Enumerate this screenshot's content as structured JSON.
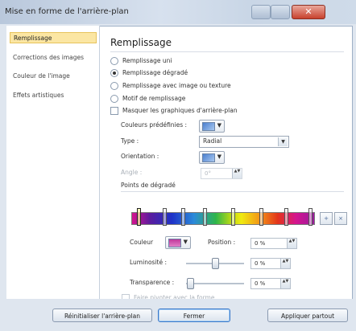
{
  "window": {
    "title": "Mise en forme de l'arrière-plan",
    "close_glyph": "✕"
  },
  "sidebar": {
    "items": [
      {
        "label": "Remplissage"
      },
      {
        "label": "Corrections des images"
      },
      {
        "label": "Couleur de l'image"
      },
      {
        "label": "Effets artistiques"
      }
    ]
  },
  "main": {
    "heading": "Remplissage",
    "fill_options": [
      {
        "label": "Remplissage uni",
        "selected": false
      },
      {
        "label": "Remplissage dégradé",
        "selected": true
      },
      {
        "label": "Remplissage avec image ou texture",
        "selected": false
      },
      {
        "label": "Motif de remplissage",
        "selected": false
      }
    ],
    "hide_graphics_label": "Masquer les graphiques d'arrière-plan",
    "preset_colors_label": "Couleurs prédéfinies :",
    "type_label": "Type :",
    "type_value": "Radial",
    "orientation_label": "Orientation :",
    "angle_label": "Angle :",
    "angle_value": "0°",
    "gradient_stops_label": "Points de dégradé",
    "color_label": "Couleur",
    "position_label": "Position :",
    "position_value": "0 %",
    "brightness_label": "Luminosité :",
    "brightness_value": "0 %",
    "transparency_label": "Transparence :",
    "transparency_value": "0 %",
    "rotate_with_shape_label": "Faire pivoter avec la forme",
    "add_stop_glyph": "+",
    "remove_stop_glyph": "×",
    "spin_glyphs": "▲▼",
    "dropdown_glyph": "▼"
  },
  "footer": {
    "reset_label": "Réinitialiser l'arrière-plan",
    "close_label": "Fermer",
    "apply_all_label": "Appliquer partout"
  }
}
